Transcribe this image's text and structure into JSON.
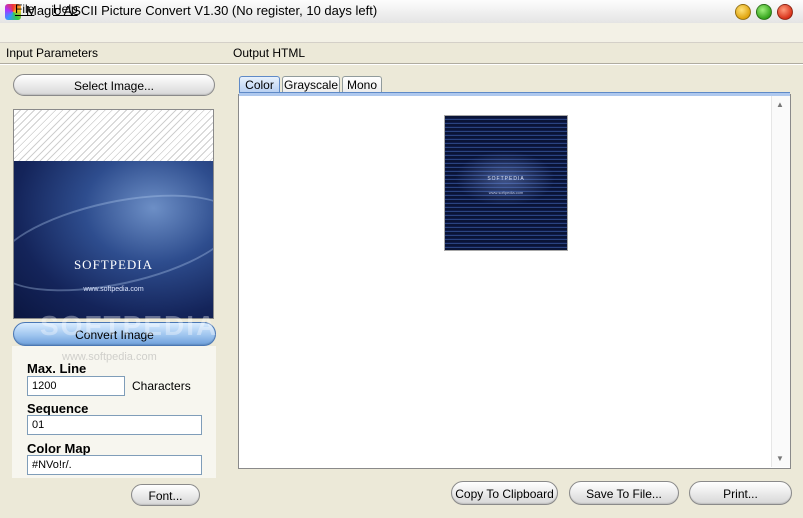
{
  "window": {
    "title": "Magic ASCII Picture Convert V1.30 (No register, 10 days left)",
    "controls": [
      "minimize",
      "maximize",
      "close"
    ]
  },
  "menu": {
    "file": "File",
    "help": "Help"
  },
  "input_panel": {
    "label": "Input Parameters",
    "select_image": "Select Image...",
    "preview_brand": "SOFTPEDIA",
    "preview_url": "www.softpedia.com",
    "convert": "Convert Image",
    "max_line_label": "Max. Line",
    "max_line_value": "1200",
    "max_line_unit": "Characters",
    "sequence_label": "Sequence",
    "sequence_value": "01",
    "color_map_label": "Color Map",
    "color_map_value": "#NVo!r/.",
    "font_button": "Font..."
  },
  "output_panel": {
    "label": "Output HTML",
    "tabs": [
      "Color",
      "Grayscale",
      "Mono"
    ],
    "active_tab": "Color",
    "ascii_brand": "SOFTPEDIA",
    "ascii_sub": "www.softpedia.com"
  },
  "actions": {
    "copy": "Copy To Clipboard",
    "save": "Save To File...",
    "print": "Print..."
  },
  "watermark": {
    "text": "SOFTPEDIA",
    "url": "www.softpedia.com"
  }
}
